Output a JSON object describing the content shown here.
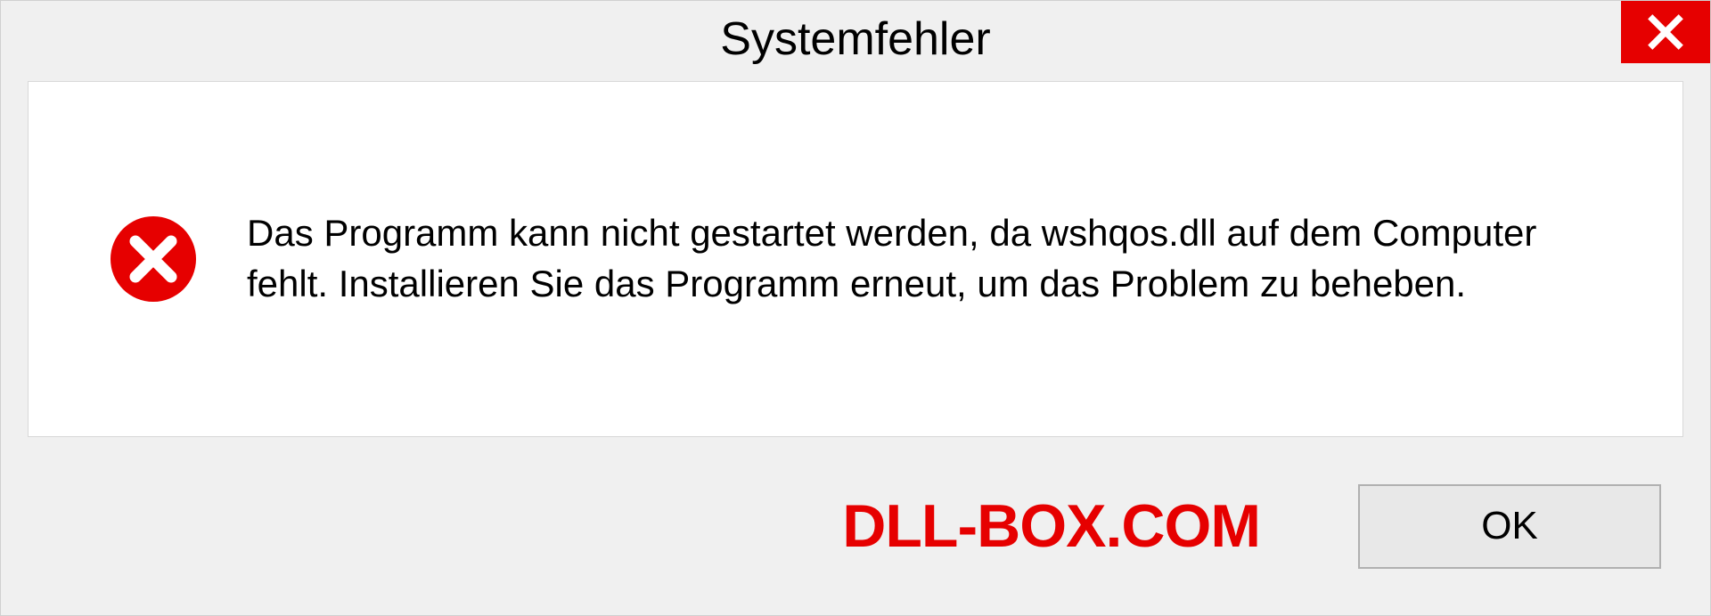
{
  "dialog": {
    "title": "Systemfehler",
    "message": "Das Programm kann nicht gestartet werden, da wshqos.dll auf dem Computer fehlt. Installieren Sie das Programm erneut, um das Problem zu beheben.",
    "ok_label": "OK"
  },
  "watermark": "DLL-BOX.COM"
}
